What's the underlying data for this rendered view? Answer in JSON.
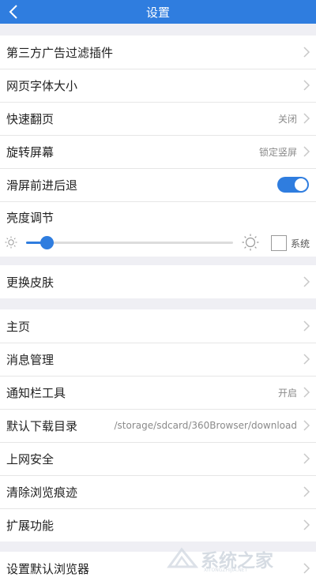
{
  "header": {
    "title": "设置"
  },
  "section1": {
    "ad_filter": "第三方广告过滤插件",
    "font_size": "网页字体大小",
    "quick_flip": {
      "label": "快速翻页",
      "value": "关闭"
    },
    "rotate": {
      "label": "旋转屏幕",
      "value": "锁定竖屏"
    },
    "swipe_nav": {
      "label": "滑屏前进后退",
      "enabled": true
    },
    "brightness": {
      "label": "亮度调节",
      "level_percent": 10,
      "system_label": "系统",
      "system_checked": false
    }
  },
  "section2": {
    "skin": "更换皮肤"
  },
  "section3": {
    "home": "主页",
    "messages": "消息管理",
    "notif_tools": {
      "label": "通知栏工具",
      "value": "开启"
    },
    "download_dir": {
      "label": "默认下载目录",
      "value": "/storage/sdcard/360Browser/download"
    },
    "security": "上网安全",
    "clear_history": "清除浏览痕迹",
    "extensions": "扩展功能"
  },
  "section4": {
    "default_browser": "设置默认浏览器"
  },
  "watermark": {
    "text": "系统之家",
    "sub": "XITONGZHIJIA.NET"
  },
  "colors": {
    "accent": "#2f7ddf",
    "background": "#efeff4"
  }
}
